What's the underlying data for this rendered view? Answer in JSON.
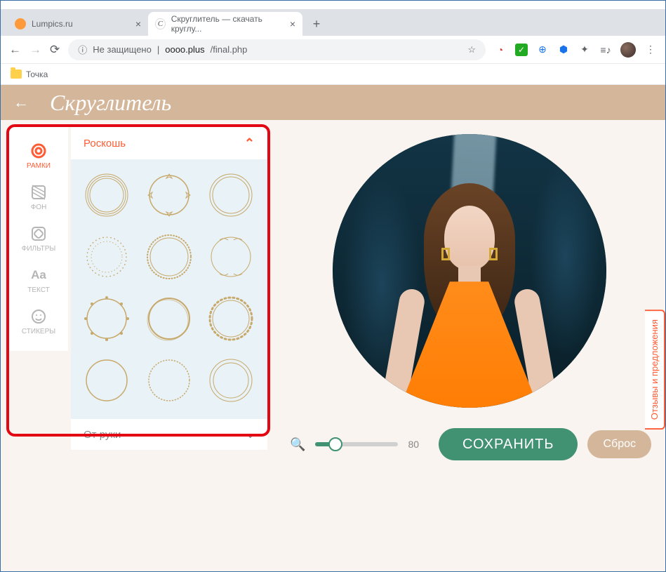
{
  "window": {
    "tabs": [
      {
        "title": "Lumpics.ru",
        "favicon_bg": "#ff9a3c",
        "favicon_txt": "",
        "active": false
      },
      {
        "title": "Скруглитель — скачать круглу...",
        "favicon_bg": "#ffffff",
        "favicon_txt": "C",
        "active": true
      }
    ]
  },
  "address": {
    "security_label": "Не защищено",
    "url_host": "oooo.plus",
    "url_path": "/final.php"
  },
  "bookmarks": {
    "item1": "Точка"
  },
  "app_header": {
    "logo": "Скруглитель"
  },
  "sidebar": {
    "items": [
      {
        "label": "РАМКИ",
        "active": true
      },
      {
        "label": "ФОН",
        "active": false
      },
      {
        "label": "ФИЛЬТРЫ",
        "active": false
      },
      {
        "label": "ТЕКСТ",
        "active": false
      },
      {
        "label": "СТИКЕРЫ",
        "active": false
      }
    ]
  },
  "panel": {
    "category_open": "Роскошь",
    "category_closed": "От руки"
  },
  "controls": {
    "zoom_value": "80",
    "save_label": "СОХРАНИТЬ",
    "reset_label": "Сброс"
  },
  "feedback_tab": "Отзывы и предложения"
}
